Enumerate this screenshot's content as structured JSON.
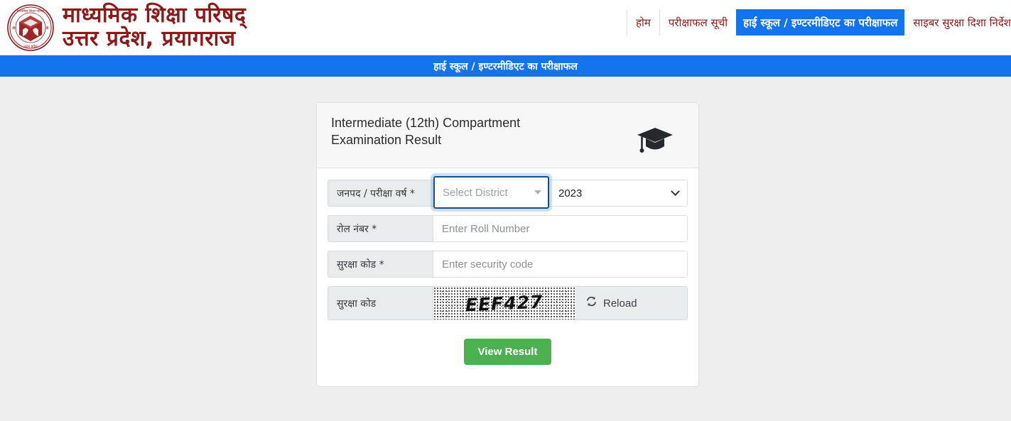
{
  "header": {
    "emblem_alt": "board-emblem",
    "brand_line1": "माध्यमिक  शिक्षा  परिषद्",
    "brand_line2": "उत्तर प्रदेश,  प्रयागराज",
    "nav": [
      {
        "label": "होम",
        "active": false
      },
      {
        "label": "परीक्षाफल सूची",
        "active": false
      },
      {
        "label": "हाई स्कूल / इण्टरमीडिएट का परीक्षाफल",
        "active": true
      },
      {
        "label": "साइबर सुरक्षा दिशा निर्देश",
        "active": false
      }
    ]
  },
  "banner": {
    "text": "हाई स्कूल / इण्टरमीडिएट का परीक्षाफल"
  },
  "card": {
    "title": "Intermediate (12th) Compartment Examination Result",
    "icon": "graduation-cap-icon",
    "form": {
      "district_row": {
        "label": "जनपद / परीक्षा वर्ष *",
        "district_placeholder": "Select District",
        "district_selected": "",
        "year_selected": "2023",
        "year_options": [
          "2023"
        ]
      },
      "roll_row": {
        "label": "रोल नंबर *",
        "placeholder": "Enter Roll Number",
        "value": ""
      },
      "security_row": {
        "label": "सुरक्षा कोड *",
        "placeholder": "Enter security code",
        "value": ""
      },
      "captcha_row": {
        "label": "सुरक्षा कोड",
        "captcha_text": "EEF427",
        "reload_label": "Reload",
        "reload_icon": "refresh-icon"
      }
    },
    "submit_label": "View Result"
  },
  "colors": {
    "brand_red": "#8b1a1a",
    "nav_active_blue": "#1273eb",
    "banner_blue": "#1273eb",
    "submit_green": "#4caf50",
    "page_bg": "#eeeeee",
    "label_bg": "#e9ecef"
  }
}
